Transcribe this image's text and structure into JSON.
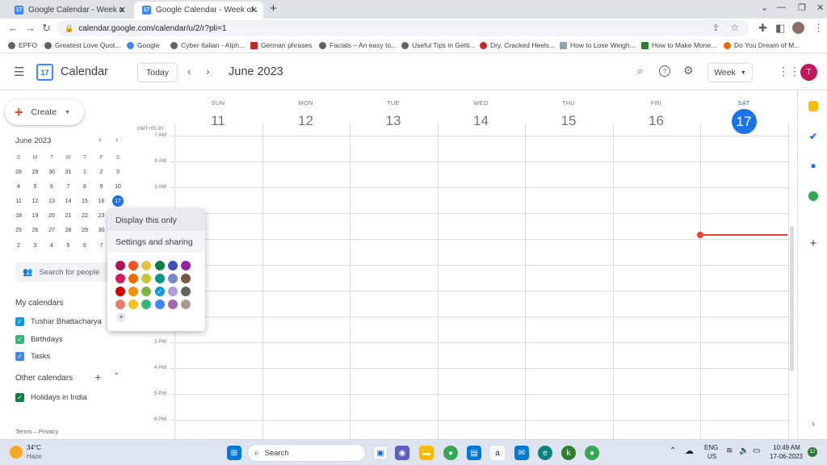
{
  "browser": {
    "tabs": [
      {
        "title": "Google Calendar - Week of 11 Ju",
        "favicon": "17"
      },
      {
        "title": "Google Calendar - Week of June",
        "favicon": "17"
      }
    ],
    "url": "calendar.google.com/calendar/u/2/r?pli=1",
    "bookmarks": [
      {
        "label": "EPFO",
        "icon": "globe-icon"
      },
      {
        "label": "Greatest Love Quot...",
        "icon": "globe-icon"
      },
      {
        "label": "Google",
        "icon": "google-icon"
      },
      {
        "label": "Cyber Italian - Alph...",
        "icon": "globe-icon"
      },
      {
        "label": "German phrases",
        "icon": "flag-icon"
      },
      {
        "label": "Facials – An easy to...",
        "icon": "globe-icon"
      },
      {
        "label": "Useful Tips in Getti...",
        "icon": "globe-icon"
      },
      {
        "label": "Dry, Cracked Heels...",
        "icon": "circle-icon"
      },
      {
        "label": "How to Lose Weigh...",
        "icon": "page-icon"
      },
      {
        "label": "How to Make Mone...",
        "icon": "q-icon"
      },
      {
        "label": "Do You Dream of M...",
        "icon": "globe-icon"
      }
    ]
  },
  "header": {
    "app_name": "Calendar",
    "logo_number": "17",
    "today_label": "Today",
    "period": "June 2023",
    "view_label": "Week",
    "avatar_letter": "T"
  },
  "sidebar": {
    "create_label": "Create",
    "mini_month": "June 2023",
    "weekday_initials": [
      "S",
      "M",
      "T",
      "W",
      "T",
      "F",
      "S"
    ],
    "mini_weeks": [
      [
        "28",
        "29",
        "30",
        "31",
        "1",
        "2",
        "3"
      ],
      [
        "4",
        "5",
        "6",
        "7",
        "8",
        "9",
        "10"
      ],
      [
        "11",
        "12",
        "13",
        "14",
        "15",
        "16",
        "17"
      ],
      [
        "18",
        "19",
        "20",
        "21",
        "22",
        "23",
        "24"
      ],
      [
        "25",
        "26",
        "27",
        "28",
        "29",
        "30",
        "1"
      ],
      [
        "2",
        "3",
        "4",
        "5",
        "6",
        "7",
        "8"
      ]
    ],
    "search_people_placeholder": "Search for people",
    "my_calendars_title": "My calendars",
    "my_calendars": [
      {
        "name": "Tushar Bhattacharya",
        "color": "#039be5"
      },
      {
        "name": "Birthdays",
        "color": "#33b679"
      },
      {
        "name": "Tasks",
        "color": "#4285f4"
      }
    ],
    "other_calendars_title": "Other calendars",
    "other_calendars": [
      {
        "name": "Holidays in India",
        "color": "#0b8043"
      }
    ],
    "footer": "Terms – Privacy"
  },
  "week": {
    "timezone": "GMT+05:30",
    "days": [
      {
        "name": "SUN",
        "date": "11"
      },
      {
        "name": "MON",
        "date": "12"
      },
      {
        "name": "TUE",
        "date": "13"
      },
      {
        "name": "WED",
        "date": "14"
      },
      {
        "name": "THU",
        "date": "15"
      },
      {
        "name": "FRI",
        "date": "16"
      },
      {
        "name": "SAT",
        "date": "17"
      }
    ],
    "hours": [
      "7 AM",
      "8 AM",
      "9 AM",
      "10 AM",
      "11 AM",
      "12 PM",
      "1 PM",
      "2 PM",
      "3 PM",
      "4 PM",
      "5 PM",
      "6 PM"
    ]
  },
  "popup": {
    "display_only": "Display this only",
    "settings_sharing": "Settings and sharing",
    "colors": [
      [
        "#ad1457",
        "#f4511e",
        "#e4c441",
        "#0b8043",
        "#3f51b5",
        "#8e24aa"
      ],
      [
        "#d81b60",
        "#ef6c00",
        "#c0ca33",
        "#009688",
        "#7986cb",
        "#795548"
      ],
      [
        "#d50000",
        "#f09300",
        "#7cb342",
        "#039be5",
        "#b39ddb",
        "#616161"
      ],
      [
        "#e67c73",
        "#f6bf26",
        "#33b679",
        "#4285f4",
        "#9e69af",
        "#a79b8e"
      ]
    ],
    "add_custom": "+"
  },
  "taskbar": {
    "weather_temp": "34°C",
    "weather_desc": "Haze",
    "search_label": "Search",
    "lang": "ENG",
    "region": "US",
    "time": "10:49 AM",
    "date": "17-06-2023",
    "notif_count": "12"
  }
}
